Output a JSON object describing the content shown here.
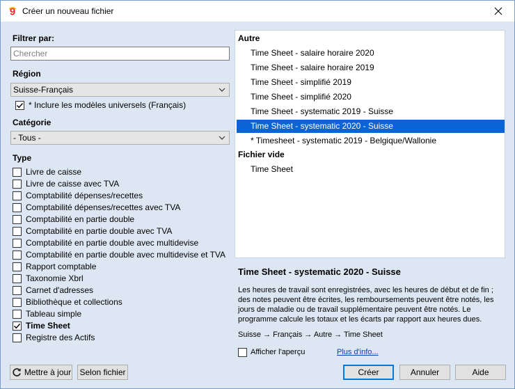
{
  "window": {
    "title": "Créer un nouveau fichier",
    "app_icon": "banana-logo-icon",
    "close_icon": "close-icon"
  },
  "filter": {
    "label": "Filtrer par:",
    "search_placeholder": "Chercher",
    "search_value": ""
  },
  "region": {
    "label": "Région",
    "selected": "Suisse-Français",
    "include_universal": {
      "label": "* Inclure les modèles universels (Français)",
      "checked": true
    }
  },
  "category": {
    "label": "Catégorie",
    "selected": "- Tous -"
  },
  "type": {
    "label": "Type",
    "items": [
      {
        "label": "Livre de caisse",
        "checked": false,
        "bold": false
      },
      {
        "label": "Livre de caisse avec TVA",
        "checked": false,
        "bold": false
      },
      {
        "label": "Comptabilité dépenses/recettes",
        "checked": false,
        "bold": false
      },
      {
        "label": "Comptabilité dépenses/recettes avec TVA",
        "checked": false,
        "bold": false
      },
      {
        "label": "Comptabilité en partie double",
        "checked": false,
        "bold": false
      },
      {
        "label": "Comptabilité en partie double avec TVA",
        "checked": false,
        "bold": false
      },
      {
        "label": "Comptabilité en partie double avec multidevise",
        "checked": false,
        "bold": false
      },
      {
        "label": "Comptabilité en partie double avec multidevise et TVA",
        "checked": false,
        "bold": false
      },
      {
        "label": "Rapport comptable",
        "checked": false,
        "bold": false
      },
      {
        "label": "Taxonomie Xbrl",
        "checked": false,
        "bold": false
      },
      {
        "label": "Carnet d'adresses",
        "checked": false,
        "bold": false
      },
      {
        "label": "Bibliothèque et collections",
        "checked": false,
        "bold": false
      },
      {
        "label": "Tableau simple",
        "checked": false,
        "bold": false
      },
      {
        "label": "Time Sheet",
        "checked": true,
        "bold": true
      },
      {
        "label": "Registre des Actifs",
        "checked": false,
        "bold": false
      }
    ]
  },
  "templates": {
    "groups": [
      {
        "name": "Autre",
        "items": [
          {
            "label": "Time Sheet - salaire horaire  2020",
            "selected": false
          },
          {
            "label": "Time Sheet - salaire horaire 2019",
            "selected": false
          },
          {
            "label": "Time Sheet - simplifié 2019",
            "selected": false
          },
          {
            "label": "Time Sheet - simplifié 2020",
            "selected": false
          },
          {
            "label": "Time Sheet - systematic 2019 - Suisse",
            "selected": false
          },
          {
            "label": "Time Sheet - systematic 2020 - Suisse",
            "selected": true
          },
          {
            "label": "* Timesheet - systematic 2019 - Belgique/Wallonie",
            "selected": false
          }
        ]
      },
      {
        "name": "Fichier vide",
        "items": [
          {
            "label": "Time Sheet",
            "selected": false
          }
        ]
      }
    ]
  },
  "details": {
    "title": "Time Sheet - systematic 2020 - Suisse",
    "description": "Les heures de travail sont enregistrées, avec les heures de début et de fin ; des notes peuvent être écrites, les remboursements peuvent être notés, les jours de maladie ou de travail supplémentaire peuvent être notés. Le programme calcule les totaux et les écarts par rapport aux heures dues.",
    "path": "Suisse → Français → Autre → Time Sheet",
    "show_preview": {
      "label": "Afficher l'aperçu",
      "checked": false
    },
    "more_info": "Plus d'info..."
  },
  "buttons": {
    "update": "Mettre à jour",
    "update_icon": "refresh-icon",
    "by_file": "Selon fichier",
    "create": "Créer",
    "cancel": "Annuler",
    "help": "Aide"
  },
  "colors": {
    "selection": "#0b64d3",
    "background": "#dde6f3",
    "link": "#0645ad"
  }
}
